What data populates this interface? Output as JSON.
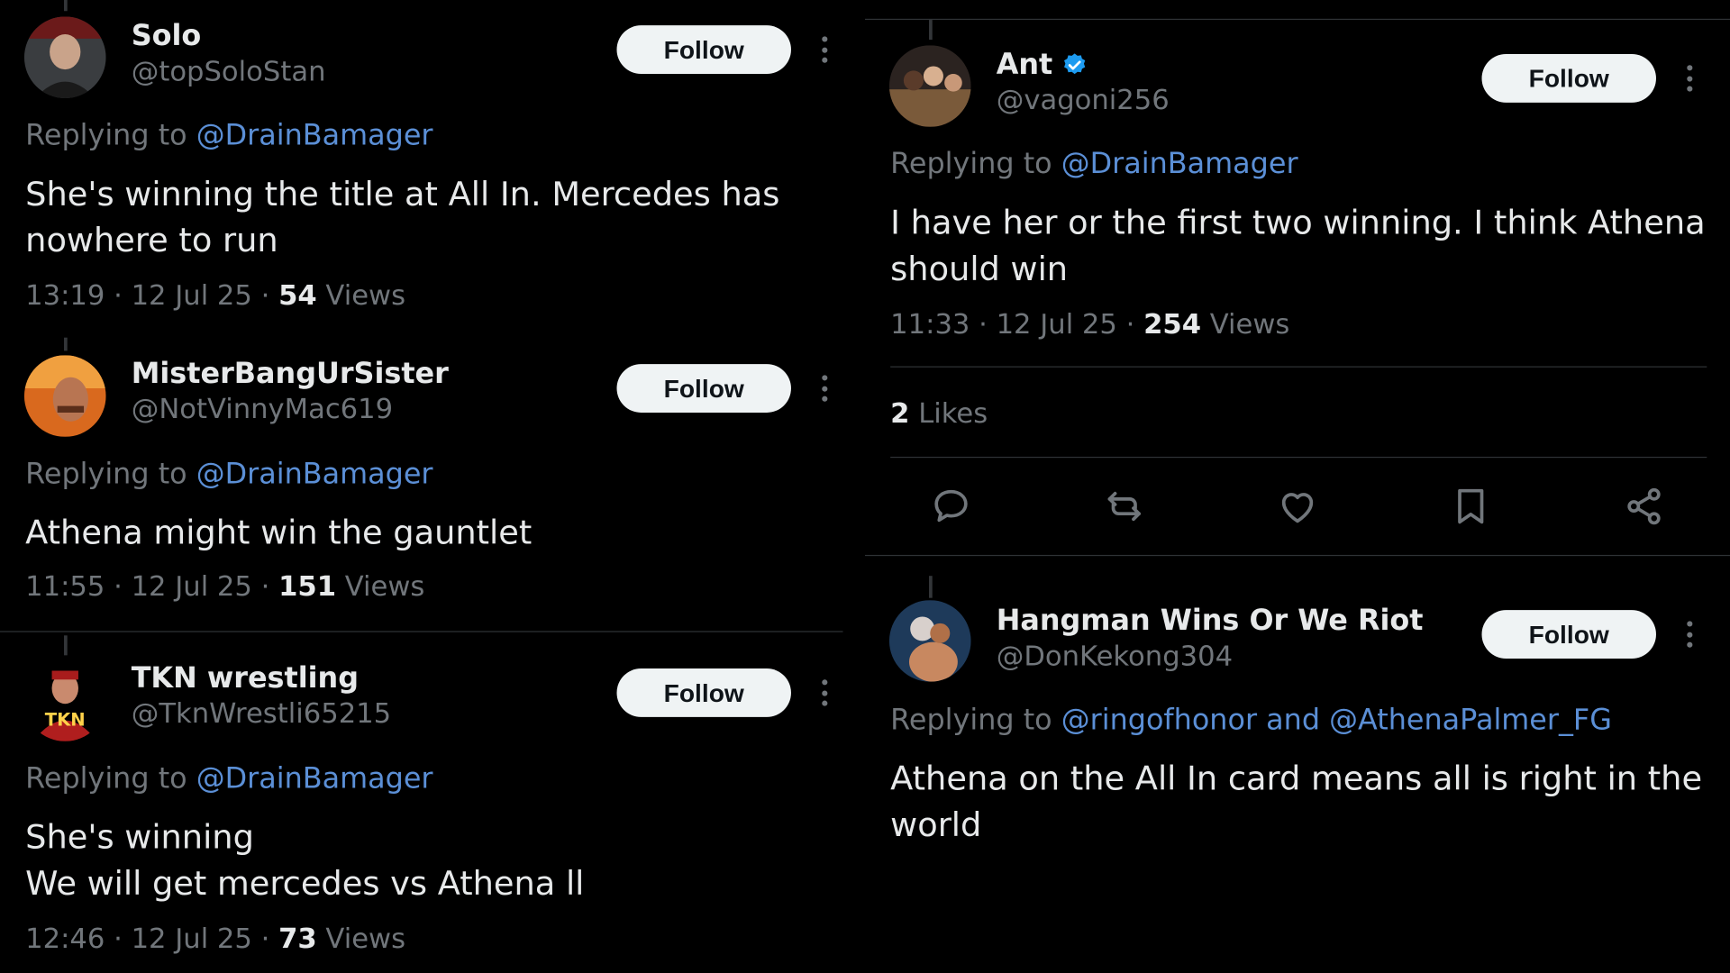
{
  "left_tweets": [
    {
      "name": "Solo",
      "handle": "@topSoloStan",
      "follow_label": "Follow",
      "replying_label": "Replying to ",
      "replying_to": "@DrainBamager",
      "body_lines": [
        "She's winning the title at All In. Mercedes has",
        "nowhere to run"
      ],
      "time": "13:19 · 12 Jul 25 · ",
      "views_count": "54",
      "views_label": " Views"
    },
    {
      "name": "MisterBangUrSister",
      "handle": "@NotVinnyMac619",
      "follow_label": "Follow",
      "replying_label": "Replying to ",
      "replying_to": "@DrainBamager",
      "body_lines": [
        "Athena might win the gauntlet"
      ],
      "time": "11:55 · 12 Jul 25 · ",
      "views_count": "151",
      "views_label": " Views"
    },
    {
      "name": "TKN wrestling",
      "handle": "@TknWrestli65215",
      "follow_label": "Follow",
      "replying_label": "Replying to ",
      "replying_to": "@DrainBamager",
      "body_lines": [
        "She's winning",
        "We will get mercedes vs Athena ll"
      ],
      "time": "12:46 · 12 Jul 25 · ",
      "views_count": "73",
      "views_label": " Views",
      "avatar_text": "TKN"
    }
  ],
  "right_main": {
    "name": "Ant",
    "handle": "@vagoni256",
    "follow_label": "Follow",
    "replying_label": "Replying to ",
    "replying_to": "@DrainBamager",
    "body_lines": [
      "I have her or the first two winning. I think Athena",
      "should win"
    ],
    "time": "11:33 · 12 Jul 25 · ",
    "views_count": "254",
    "views_label": " Views",
    "likes_count": "2",
    "likes_label": " Likes",
    "verified": true
  },
  "right_reply": {
    "name": "Hangman Wins Or We Riot",
    "handle": "@DonKekong304",
    "follow_label": "Follow",
    "replying_label": "Replying to ",
    "replying_to": "@ringofhonor and @AthenaPalmer_FG",
    "body_lines": [
      "Athena on the All In card means all is right in the",
      "world"
    ]
  },
  "actions": [
    "reply-icon",
    "retweet-icon",
    "like-icon",
    "bookmark-icon",
    "share-icon"
  ],
  "colors": {
    "background": "#000000",
    "text": "#e7e9ea",
    "muted": "#71767b",
    "mention": "#5b8fd6",
    "verified": "#1d9bf0",
    "button_bg": "#eff3f4"
  }
}
